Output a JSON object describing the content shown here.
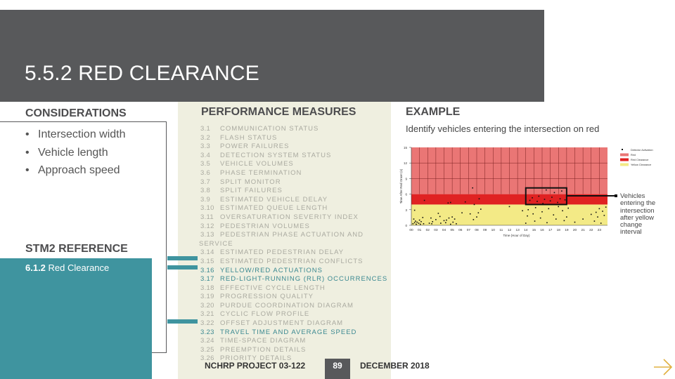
{
  "slide": {
    "title": "5.5.2 RED CLEARANCE",
    "page_number": "89",
    "footer_project": "NCHRP PROJECT 03-122",
    "footer_date": "DECEMBER 2018",
    "next_icon": "arrow-right-icon"
  },
  "colors": {
    "header": "#58595b",
    "teal": "#3f949f",
    "panel": "#efefe0",
    "arrow": "#e0b040",
    "red": "#ea7675",
    "red_clearance": "#e02222",
    "yellow_clearance": "#f3ea86"
  },
  "considerations": {
    "heading": "CONSIDERATIONS",
    "items": [
      "Intersection width",
      "Vehicle length",
      "Approach speed"
    ]
  },
  "stm2": {
    "heading": "STM2 REFERENCE",
    "ref_number": "6.1.2",
    "ref_title": "Red Clearance"
  },
  "performance_measures": {
    "heading": "PERFORMANCE MEASURES",
    "items": [
      {
        "num": "3.1",
        "label": "COMMUNICATION STATUS",
        "active": false
      },
      {
        "num": "3.2",
        "label": "FLASH STATUS",
        "active": false
      },
      {
        "num": "3.3",
        "label": "POWER FAILURES",
        "active": false
      },
      {
        "num": "3.4",
        "label": "DETECTION SYSTEM STATUS",
        "active": false
      },
      {
        "num": "3.5",
        "label": "VEHICLE VOLUMES",
        "active": false
      },
      {
        "num": "3.6",
        "label": "PHASE TERMINATION",
        "active": false
      },
      {
        "num": "3.7",
        "label": "SPLIT MONITOR",
        "active": false
      },
      {
        "num": "3.8",
        "label": "SPLIT FAILURES",
        "active": false
      },
      {
        "num": "3.9",
        "label": "ESTIMATED VEHICLE DELAY",
        "active": false
      },
      {
        "num": "3.10",
        "label": "ESTIMATED QUEUE LENGTH",
        "active": false
      },
      {
        "num": "3.11",
        "label": "OVERSATURATION SEVERITY INDEX",
        "active": false
      },
      {
        "num": "3.12",
        "label": "PEDESTRIAN VOLUMES",
        "active": false
      },
      {
        "num": "3.13",
        "label": "PEDESTRIAN PHASE ACTUATION AND",
        "continuation": "SERVICE",
        "active": false
      },
      {
        "num": "3.14",
        "label": "ESTIMATED PEDESTRIAN DELAY",
        "active": false
      },
      {
        "num": "3.15",
        "label": "ESTIMATED PEDESTRIAN CONFLICTS",
        "active": false
      },
      {
        "num": "3.16",
        "label": "YELLOW/RED ACTUATIONS",
        "active": true
      },
      {
        "num": "3.17",
        "label": "RED-LIGHT-RUNNING (RLR) OCCURRENCES",
        "active": true
      },
      {
        "num": "3.18",
        "label": "EFFECTIVE CYCLE LENGTH",
        "active": false
      },
      {
        "num": "3.19",
        "label": "PROGRESSION QUALITY",
        "active": false
      },
      {
        "num": "3.20",
        "label": "PURDUE COORDINATION DIAGRAM",
        "active": false
      },
      {
        "num": "3.21",
        "label": "CYCLIC FLOW PROFILE",
        "active": false
      },
      {
        "num": "3.22",
        "label": "OFFSET ADJUSTMENT DIAGRAM",
        "active": false
      },
      {
        "num": "3.23",
        "label": "TRAVEL TIME AND AVERAGE SPEED",
        "active": true
      },
      {
        "num": "3.24",
        "label": "TIME-SPACE DIAGRAM",
        "active": false
      },
      {
        "num": "3.25",
        "label": "PREEMPTION DETAILS",
        "active": false
      },
      {
        "num": "3.26",
        "label": "PRIORITY DETAILS",
        "active": false
      }
    ]
  },
  "example": {
    "heading": "EXAMPLE",
    "description": "Identify vehicles entering the intersection on red",
    "callout": [
      "Vehicles",
      "entering the",
      "intersection",
      "after yellow",
      "change",
      "interval"
    ]
  },
  "chart_data": {
    "type": "scatter",
    "title": "",
    "xlabel": "Time (Hour of Day)",
    "ylabel": "Time After Red Onset (s)",
    "xlim": [
      0,
      24
    ],
    "ylim": [
      0,
      15
    ],
    "x_ticks": [
      "00",
      "01",
      "02",
      "03",
      "04",
      "05",
      "06",
      "07",
      "08",
      "09",
      "10",
      "11",
      "12",
      "13",
      "14",
      "15",
      "16",
      "17",
      "18",
      "19",
      "20",
      "21",
      "22",
      "23"
    ],
    "y_ticks": [
      0,
      3,
      6,
      9,
      12,
      15
    ],
    "grid": true,
    "legend_position": "right",
    "legend": [
      {
        "label": "Detector Activation",
        "type": "marker"
      },
      {
        "label": "Red",
        "band": "red"
      },
      {
        "label": "Red Clearance",
        "band": "red_clearance"
      },
      {
        "label": "Yellow Clearance",
        "band": "yellow_clearance"
      }
    ],
    "bands": [
      {
        "name": "Yellow Clearance",
        "from": 0,
        "to": 4
      },
      {
        "name": "Red Clearance",
        "from": 4,
        "to": 6
      },
      {
        "name": "Red",
        "from": 6,
        "to": 15
      }
    ],
    "highlight_box": {
      "x": [
        14,
        19
      ],
      "y": [
        4,
        7.2
      ],
      "label": "Vehicles entering the intersection after yellow change interval"
    },
    "series": [
      {
        "name": "Detector Activation",
        "points": [
          [
            0.2,
            0.3
          ],
          [
            0.3,
            1.2
          ],
          [
            0.4,
            0.5
          ],
          [
            0.5,
            0.8
          ],
          [
            0.6,
            0.2
          ],
          [
            0.7,
            0.6
          ],
          [
            0.9,
            0.4
          ],
          [
            1.0,
            1.0
          ],
          [
            1.1,
            0.2
          ],
          [
            1.2,
            0.7
          ],
          [
            1.4,
            1.5
          ],
          [
            1.5,
            0.3
          ],
          [
            0.4,
            2.9
          ],
          [
            1.6,
            4.8
          ],
          [
            2.2,
            0.4
          ],
          [
            2.4,
            1.4
          ],
          [
            2.5,
            0.3
          ],
          [
            2.6,
            0.7
          ],
          [
            3.0,
            1.1
          ],
          [
            3.3,
            2.3
          ],
          [
            3.5,
            1.7
          ],
          [
            3.6,
            0.4
          ],
          [
            4.0,
            0.9
          ],
          [
            4.2,
            0.5
          ],
          [
            4.3,
            1.0
          ],
          [
            4.6,
            1.4
          ],
          [
            4.8,
            0.2
          ],
          [
            4.5,
            4.3
          ],
          [
            4.8,
            4.4
          ],
          [
            5.0,
            1.6
          ],
          [
            5.1,
            0.6
          ],
          [
            5.3,
            1.2
          ],
          [
            5.5,
            0.3
          ],
          [
            6.2,
            2.4
          ],
          [
            6.6,
            4.5
          ],
          [
            7.2,
            2.2
          ],
          [
            7.5,
            7.2
          ],
          [
            7.6,
            1.1
          ],
          [
            7.7,
            4.0
          ],
          [
            8.0,
            1.6
          ],
          [
            8.3,
            5.1
          ],
          [
            8.5,
            3.1
          ],
          [
            8.2,
            2.4
          ],
          [
            12.0,
            3.6
          ],
          [
            13.6,
            2.8
          ],
          [
            14.0,
            0.4
          ],
          [
            14.2,
            1.8
          ],
          [
            14.3,
            3.0
          ],
          [
            14.5,
            4.8
          ],
          [
            14.8,
            5.3
          ],
          [
            14.9,
            2.2
          ],
          [
            15.1,
            0.8
          ],
          [
            15.2,
            3.4
          ],
          [
            15.4,
            4.6
          ],
          [
            15.6,
            5.6
          ],
          [
            15.8,
            1.4
          ],
          [
            16.0,
            2.6
          ],
          [
            16.1,
            4.2
          ],
          [
            16.3,
            5.0
          ],
          [
            16.5,
            6.8
          ],
          [
            16.6,
            0.5
          ],
          [
            16.8,
            3.2
          ],
          [
            17.0,
            4.7
          ],
          [
            17.2,
            5.4
          ],
          [
            17.4,
            2.0
          ],
          [
            17.5,
            6.3
          ],
          [
            17.7,
            1.2
          ],
          [
            17.9,
            4.4
          ],
          [
            18.0,
            3.6
          ],
          [
            18.2,
            5.1
          ],
          [
            18.4,
            6.6
          ],
          [
            18.5,
            2.8
          ],
          [
            18.7,
            0.9
          ],
          [
            18.8,
            4.9
          ],
          [
            19.0,
            1.6
          ],
          [
            19.2,
            3.3
          ],
          [
            20.0,
            0.6
          ],
          [
            21.0,
            1.2
          ],
          [
            22.0,
            2.1
          ],
          [
            22.4,
            0.8
          ],
          [
            22.6,
            2.5
          ],
          [
            22.8,
            1.6
          ],
          [
            23.0,
            3.2
          ],
          [
            23.2,
            0.4
          ],
          [
            23.4,
            2.7
          ],
          [
            23.6,
            1.9
          ],
          [
            23.8,
            3.5
          ]
        ]
      }
    ]
  }
}
